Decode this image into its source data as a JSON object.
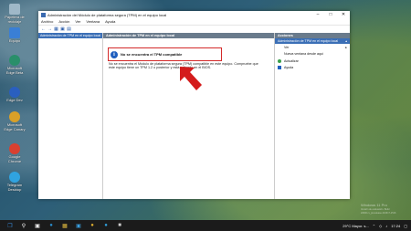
{
  "desktop": {
    "icons": [
      {
        "label": "Papelera de reciclaje",
        "color": "#9fb8c8"
      },
      {
        "label": "Equipo",
        "color": "#3a7fd5"
      },
      {
        "label": "Microsoft Edge Beta",
        "color": "#2a8f6a"
      },
      {
        "label": "Edge Dev",
        "color": "#2a5fbf"
      },
      {
        "label": "Microsoft Edge Canary",
        "color": "#d9a028"
      },
      {
        "label": "Google Chrome",
        "color": "#d84030"
      },
      {
        "label": "Telegram Desktop",
        "color": "#30a3e0"
      }
    ],
    "watermark": [
      "Windows 11 Pro",
      "Versión de evaluación. Build 22000.rs_prerelease.210617-1516"
    ]
  },
  "window": {
    "title": "Administración del Módulo de plataforma segura (TPM) en el equipo local",
    "menu": [
      "Archivo",
      "Acción",
      "Ver",
      "Ventana",
      "Ayuda"
    ],
    "left_pane_item": "Administración de TPM en el equipo local",
    "center_header": "Administración de TPM en el equipo local",
    "alert_text": "No se encuentra el TPM compatible",
    "description": "No se encuentra el Módulo de plataforma segura (TPM) compatible en este equipo. Compruebe que este equipo tiene un TPM 1.2 o posterior y está activado en el BIOS.",
    "actions_header": "Acciones",
    "actions_selected": "Administración de TPM en el equipo local",
    "actions": [
      {
        "label": "Ver",
        "has_submenu": true
      },
      {
        "label": "Nueva ventana desde aquí",
        "has_submenu": false
      },
      {
        "label": "Actualizar",
        "has_submenu": false
      },
      {
        "label": "Ayuda",
        "has_submenu": false
      }
    ]
  },
  "taskbar": {
    "weather": "29°C  Mayor. s...",
    "time": "17:24"
  },
  "colors": {
    "accent": "#3b6fb6",
    "alert_border": "#d42a2a",
    "arrow": "#d41c1c"
  }
}
